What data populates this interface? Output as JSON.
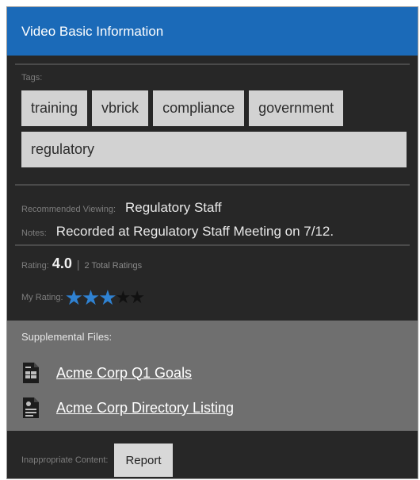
{
  "header": {
    "title": "Video Basic Information"
  },
  "tags": {
    "label": "Tags:",
    "items": [
      "training",
      "vbrick",
      "compliance",
      "government",
      "regulatory"
    ]
  },
  "info": {
    "recommended_label": "Recommended Viewing:",
    "recommended_value": "Regulatory Staff",
    "notes_label": "Notes:",
    "notes_value": "Recorded at Regulatory Staff Meeting on 7/12."
  },
  "rating": {
    "label": "Rating:",
    "value": "4.0",
    "separator": "|",
    "total": "2 Total Ratings",
    "my_rating_label": "My Rating:",
    "my_rating_stars": 3,
    "max_stars": 5,
    "star_on_color": "#2f82d2",
    "star_off_color": "#111111"
  },
  "supplemental": {
    "title": "Supplemental Files:",
    "files": [
      {
        "name": "Acme Corp Q1 Goals",
        "icon": "spreadsheet-file-icon"
      },
      {
        "name": "Acme Corp Directory Listing",
        "icon": "document-file-icon"
      }
    ]
  },
  "inappropriate": {
    "label": "Inappropriate Content:",
    "button_label": "Report"
  },
  "colors": {
    "header_bg": "#1b6ab8",
    "panel_bg": "#272727",
    "supplemental_bg": "#6f6f6f",
    "tag_bg": "#d2d2d2"
  }
}
